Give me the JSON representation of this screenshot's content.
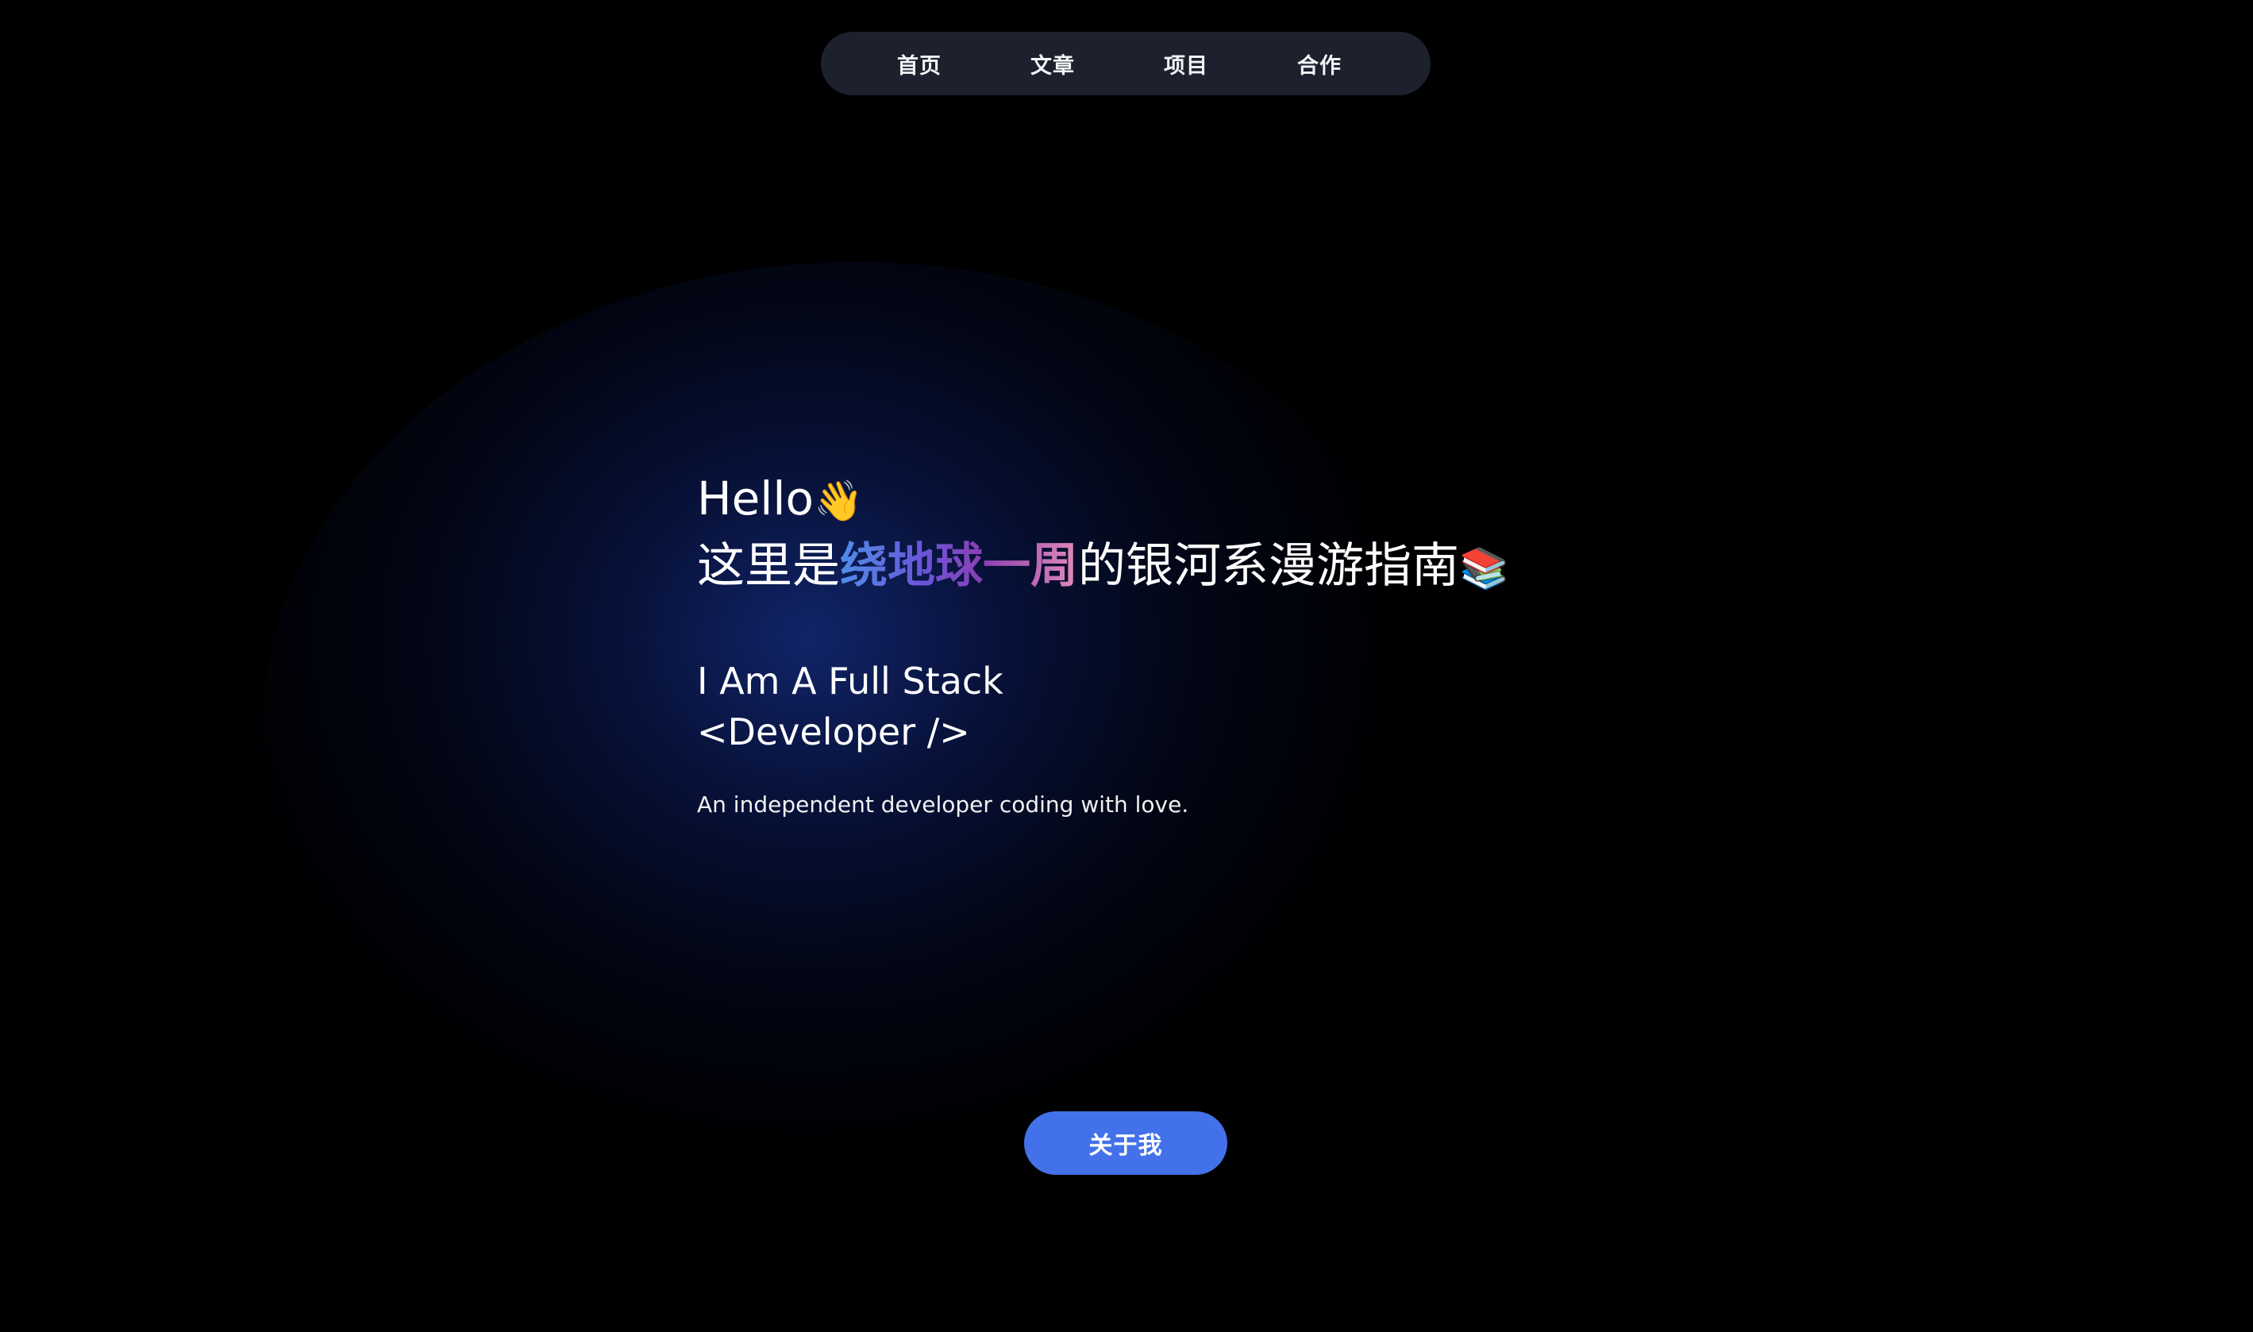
{
  "nav": {
    "items": [
      {
        "label": "首页"
      },
      {
        "label": "文章"
      },
      {
        "label": "项目"
      },
      {
        "label": "合作"
      }
    ]
  },
  "hero": {
    "greeting": "Hello",
    "greeting_emoji": "👋",
    "tagline_prefix": "这里是",
    "tagline_highlight": "绕地球一周",
    "tagline_suffix": "的银河系漫游指南",
    "tagline_emoji": "📚",
    "role_line1": "I Am A Full Stack",
    "role_line2": "<Developer />",
    "description": "An independent developer coding with love."
  },
  "cta": {
    "label": "关于我"
  },
  "colors": {
    "background": "#000000",
    "nav_background": "#1c212d",
    "button": "#4371e9",
    "highlight_gradient": [
      "#4f8fe8",
      "#6a55d8",
      "#8b3fb4",
      "#e28ab6"
    ]
  }
}
